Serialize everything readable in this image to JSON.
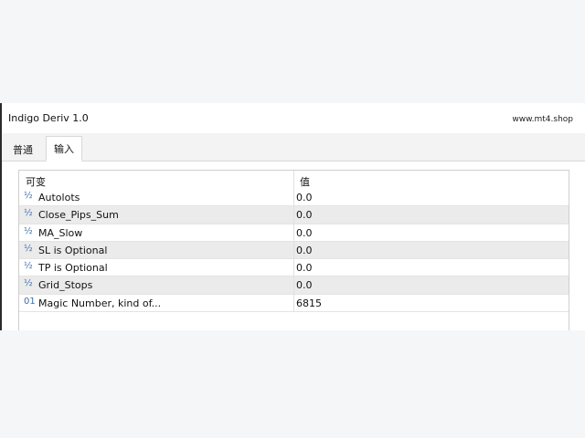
{
  "window": {
    "title": "Indigo Deriv 1.0",
    "site": "www.mt4.shop"
  },
  "tabs": [
    {
      "label": "普通"
    },
    {
      "label": "输入",
      "selected": true
    }
  ],
  "table": {
    "headers": {
      "variable": "可变",
      "value": "值"
    },
    "rows": [
      {
        "icon": "½",
        "icon_name": "double-type-icon",
        "name": "Autolots",
        "value": "0.0"
      },
      {
        "icon": "½",
        "icon_name": "double-type-icon",
        "name": "Close_Pips_Sum",
        "value": "0.0"
      },
      {
        "icon": "½",
        "icon_name": "double-type-icon",
        "name": "MA_Slow",
        "value": "0.0"
      },
      {
        "icon": "½",
        "icon_name": "double-type-icon",
        "name": "SL is Optional",
        "value": "0.0"
      },
      {
        "icon": "½",
        "icon_name": "double-type-icon",
        "name": "TP is Optional",
        "value": "0.0"
      },
      {
        "icon": "½",
        "icon_name": "double-type-icon",
        "name": "Grid_Stops",
        "value": "0.0"
      },
      {
        "icon": "01",
        "icon_name": "integer-type-icon",
        "name": "Magic Number, kind of...",
        "value": "6815"
      }
    ]
  }
}
